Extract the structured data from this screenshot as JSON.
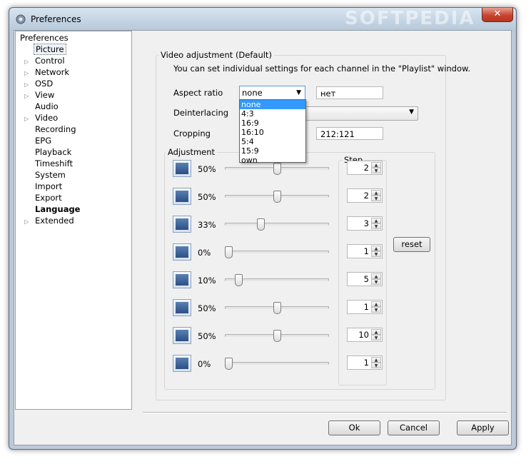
{
  "window": {
    "title": "Preferences",
    "close_label": "✕",
    "watermark": "SOFTPEDIA"
  },
  "tree": {
    "root": "Preferences",
    "items": [
      {
        "label": "Picture",
        "expandable": false,
        "selected": true,
        "bold": false
      },
      {
        "label": "Control",
        "expandable": true,
        "selected": false,
        "bold": false
      },
      {
        "label": "Network",
        "expandable": true,
        "selected": false,
        "bold": false
      },
      {
        "label": "OSD",
        "expandable": true,
        "selected": false,
        "bold": false
      },
      {
        "label": "View",
        "expandable": true,
        "selected": false,
        "bold": false
      },
      {
        "label": "Audio",
        "expandable": false,
        "selected": false,
        "bold": false
      },
      {
        "label": "Video",
        "expandable": true,
        "selected": false,
        "bold": false
      },
      {
        "label": "Recording",
        "expandable": false,
        "selected": false,
        "bold": false
      },
      {
        "label": "EPG",
        "expandable": false,
        "selected": false,
        "bold": false
      },
      {
        "label": "Playback",
        "expandable": false,
        "selected": false,
        "bold": false
      },
      {
        "label": "Timeshift",
        "expandable": false,
        "selected": false,
        "bold": false
      },
      {
        "label": "System",
        "expandable": false,
        "selected": false,
        "bold": false
      },
      {
        "label": "Import",
        "expandable": false,
        "selected": false,
        "bold": false
      },
      {
        "label": "Export",
        "expandable": false,
        "selected": false,
        "bold": false
      },
      {
        "label": "Language",
        "expandable": false,
        "selected": false,
        "bold": true
      },
      {
        "label": "Extended",
        "expandable": true,
        "selected": false,
        "bold": false
      }
    ]
  },
  "video": {
    "group_title": "Video adjustment (Default)",
    "info": "You can set individual settings for each channel in the \"Playlist\" window.",
    "aspect_label": "Aspect ratio",
    "aspect_value": "none",
    "aspect_text": "нет",
    "deinterlacing_label": "Deinterlacing",
    "cropping_label": "Cropping",
    "cropping_value": "212:121",
    "aspect_options": [
      "none",
      "4:3",
      "16:9",
      "16:10",
      "5:4",
      "15:9",
      "own"
    ],
    "aspect_selected_index": 0
  },
  "adjustment": {
    "group_title": "Adjustment",
    "step_title": "Step",
    "reset_label": "reset",
    "rows": [
      {
        "icon": "brightness-icon",
        "value": "50%",
        "level": 0.5,
        "step": "2"
      },
      {
        "icon": "contrast-icon",
        "value": "50%",
        "level": 0.5,
        "step": "2"
      },
      {
        "icon": "saturation-icon",
        "value": "33%",
        "level": 0.33,
        "step": "3"
      },
      {
        "icon": "hue-icon",
        "value": "0%",
        "level": 0.0,
        "step": "1"
      },
      {
        "icon": "gamma-icon",
        "value": "10%",
        "level": 0.1,
        "step": "5"
      },
      {
        "icon": "sharpness-icon",
        "value": "50%",
        "level": 0.5,
        "step": "1"
      },
      {
        "icon": "volume-icon",
        "value": "50%",
        "level": 0.5,
        "step": "10"
      },
      {
        "icon": "noise-reduction-icon",
        "value": "0%",
        "level": 0.0,
        "step": "1"
      }
    ]
  },
  "buttons": {
    "ok": "Ok",
    "cancel": "Cancel",
    "apply": "Apply"
  }
}
